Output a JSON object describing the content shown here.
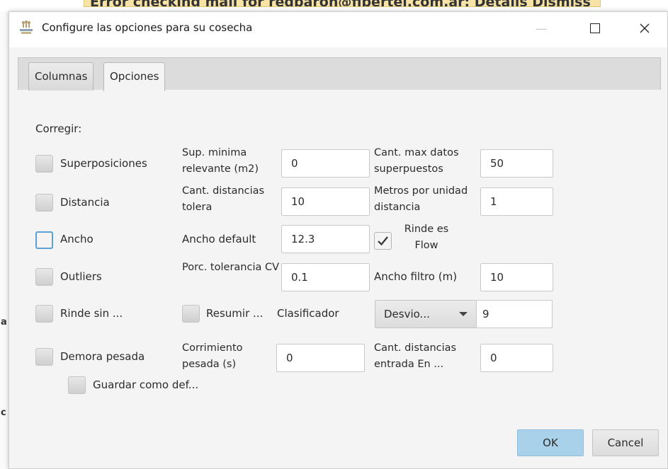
{
  "background": {
    "banner_text": "Error checking mail for redbaron@fibertel.com.ar: Details Dismiss",
    "left_glyphs": [
      "a",
      "c"
    ]
  },
  "window": {
    "title": "Configure las opciones para su cosecha",
    "controls": {
      "minimize": "—",
      "maximize": "☐",
      "close": "✕"
    }
  },
  "tabs": [
    {
      "label": "Columnas",
      "selected": false
    },
    {
      "label": "Opciones",
      "selected": true
    }
  ],
  "section_label": "Corregir:",
  "rows": {
    "superposiciones": {
      "checkbox_label": "Superposiciones",
      "field1_label": "Sup. minima relevante (m2)",
      "field1_value": "0",
      "field2_label": "Cant. max datos superpuestos",
      "field2_value": "50"
    },
    "distancia": {
      "checkbox_label": "Distancia",
      "field1_label": "Cant. distancias tolera",
      "field1_value": "10",
      "field2_label": "Metros por unidad distancia",
      "field2_value": "1"
    },
    "ancho": {
      "checkbox_label": "Ancho",
      "field1_label": "Ancho default",
      "field1_value": "12.3",
      "rinde_flow_label": "Rinde es Flow",
      "rinde_flow_checked": true
    },
    "outliers": {
      "checkbox_label": "Outliers",
      "field1_label": "Porc. tolerancia CV",
      "field1_value": "0.1",
      "field2_label": "Ancho filtro (m)",
      "field2_value": "10"
    },
    "rinde_sin": {
      "checkbox_label": "Rinde sin ...",
      "resumir_label": "Resumir ...",
      "clasificador_label": "Clasificador",
      "clasificador_selected": "Desvio...",
      "clasificador_value": "9"
    },
    "demora": {
      "checkbox_label": "Demora pesada",
      "field1_label": "Corrimiento pesada (s)",
      "field1_value": "0",
      "field2_label": "Cant. distancias entrada En ...",
      "field2_value": "0"
    }
  },
  "guardar_label": "Guardar como def...",
  "buttons": {
    "ok": "OK",
    "cancel": "Cancel"
  },
  "colors": {
    "accent": "#5ba0d6",
    "ok_button": "#a9d2ea",
    "banner": "#f7e3a6"
  }
}
